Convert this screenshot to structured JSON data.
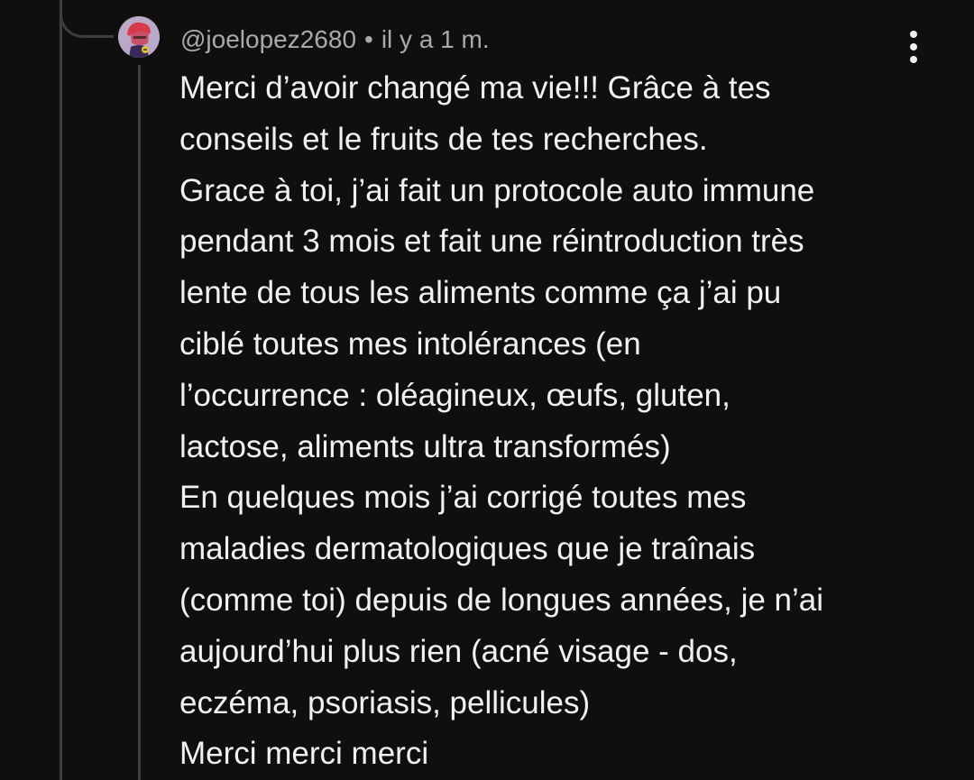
{
  "comment": {
    "author": "@joelopez2680",
    "separator": "•",
    "time": "il y a 1 m.",
    "lines": [
      "Merci d’avoir changé ma vie!!! Grâce à tes",
      "conseils et le fruits de tes recherches.",
      "Grace à toi, j’ai fait un protocole auto immune",
      "pendant 3 mois et fait une réintroduction très",
      "lente de tous les aliments comme ça j’ai pu",
      "ciblé toutes mes intolérances (en",
      "l’occurrence : oléagineux, œufs, gluten,",
      "lactose, aliments ultra transformés)",
      "En quelques mois j’ai corrigé toutes mes",
      "maladies dermatologiques que je traînais",
      "(comme toi) depuis de longues années, je n’ai",
      "aujourd’hui plus rien (acné visage - dos,",
      "eczéma, psoriasis, pellicules)",
      "Merci merci merci"
    ]
  },
  "icons": {
    "menu": "more-vertical-icon",
    "avatar": "user-avatar"
  },
  "colors": {
    "background": "#0f0f0f",
    "text_primary": "#f1f1f1",
    "text_secondary": "#aaaaaa",
    "thread_line": "#3d3d3d"
  }
}
